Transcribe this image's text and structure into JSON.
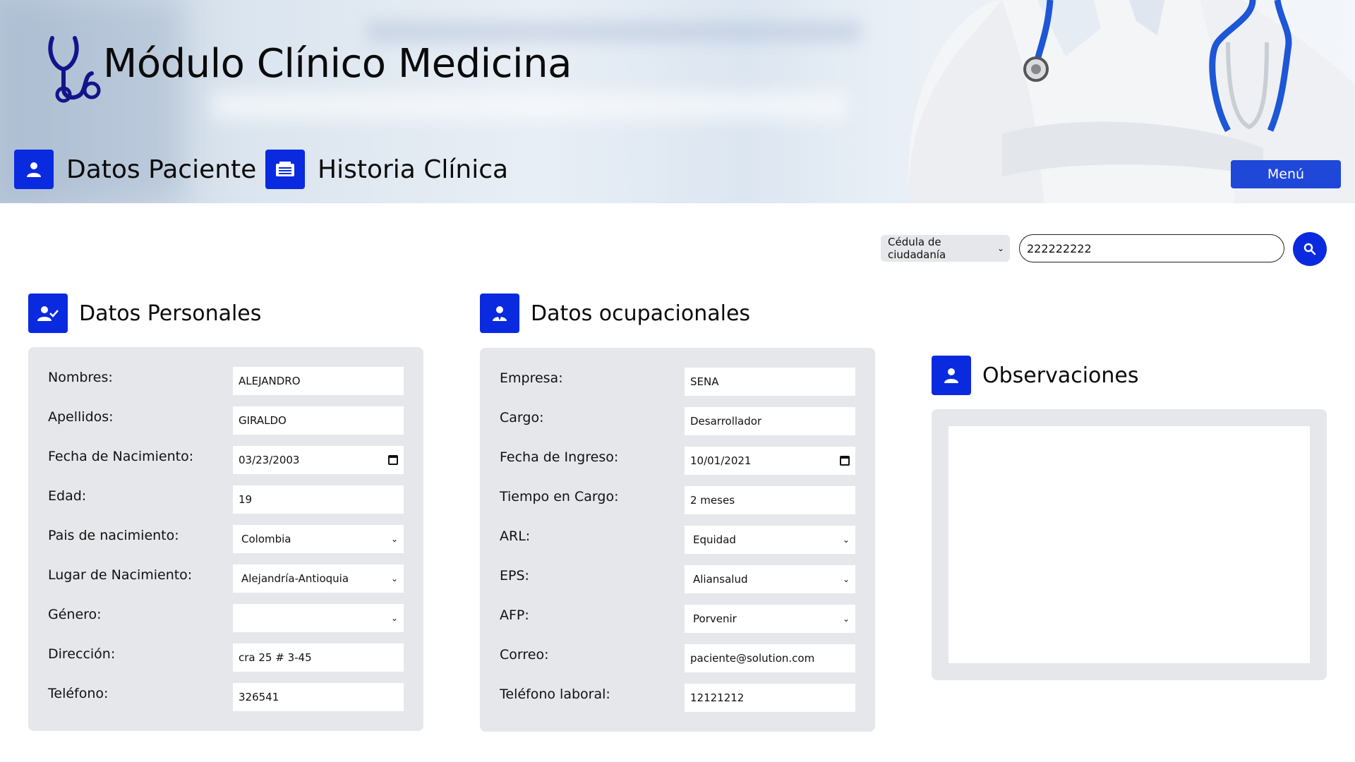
{
  "header": {
    "title": "Módulo Clínico Medicina",
    "nav": [
      {
        "label": "Datos Paciente",
        "icon": "user-icon"
      },
      {
        "label": "Historia Clínica",
        "icon": "folder-icon"
      }
    ],
    "menu_label": "Menú"
  },
  "search": {
    "doc_type": "Cédula de ciudadanía",
    "value": "222222222",
    "button_icon": "search-icon"
  },
  "personal": {
    "title": "Datos Personales",
    "icon": "user-check-icon",
    "fields": [
      {
        "label": "Nombres:",
        "value": "ALEJANDRO",
        "type": "text"
      },
      {
        "label": "Apellidos:",
        "value": "GIRALDO",
        "type": "text"
      },
      {
        "label": "Fecha de Nacimiento:",
        "value": "03/23/2003",
        "type": "date"
      },
      {
        "label": "Edad:",
        "value": "19",
        "type": "text"
      },
      {
        "label": "Pais de nacimiento:",
        "value": "Colombia",
        "type": "select"
      },
      {
        "label": "Lugar de Nacimiento:",
        "value": "Alejandría-Antioquia",
        "type": "select"
      },
      {
        "label": "Género:",
        "value": "",
        "type": "select"
      },
      {
        "label": "Dirección:",
        "value": "cra 25 # 3-45",
        "type": "text"
      },
      {
        "label": "Teléfono:",
        "value": "326541",
        "type": "text"
      }
    ]
  },
  "occupational": {
    "title": "Datos ocupacionales",
    "icon": "user-tie-icon",
    "fields": [
      {
        "label": "Empresa:",
        "value": "SENA",
        "type": "text"
      },
      {
        "label": "Cargo:",
        "value": "Desarrollador",
        "type": "text"
      },
      {
        "label": "Fecha de Ingreso:",
        "value": "10/01/2021",
        "type": "date"
      },
      {
        "label": "Tiempo en Cargo:",
        "value": "2 meses",
        "type": "text"
      },
      {
        "label": "ARL:",
        "value": "Equidad",
        "type": "select"
      },
      {
        "label": "EPS:",
        "value": "Aliansalud",
        "type": "select"
      },
      {
        "label": "AFP:",
        "value": "Porvenir",
        "type": "select"
      },
      {
        "label": "Correo:",
        "value": "paciente@solution.com",
        "type": "text"
      },
      {
        "label": "Teléfono laboral:",
        "value": "12121212",
        "type": "text"
      }
    ]
  },
  "observations": {
    "title": "Observaciones",
    "icon": "user-icon",
    "value": ""
  },
  "colors": {
    "accent": "#0a2ae0",
    "menu_button": "#1f47d8",
    "panel": "#e6e7ea"
  }
}
